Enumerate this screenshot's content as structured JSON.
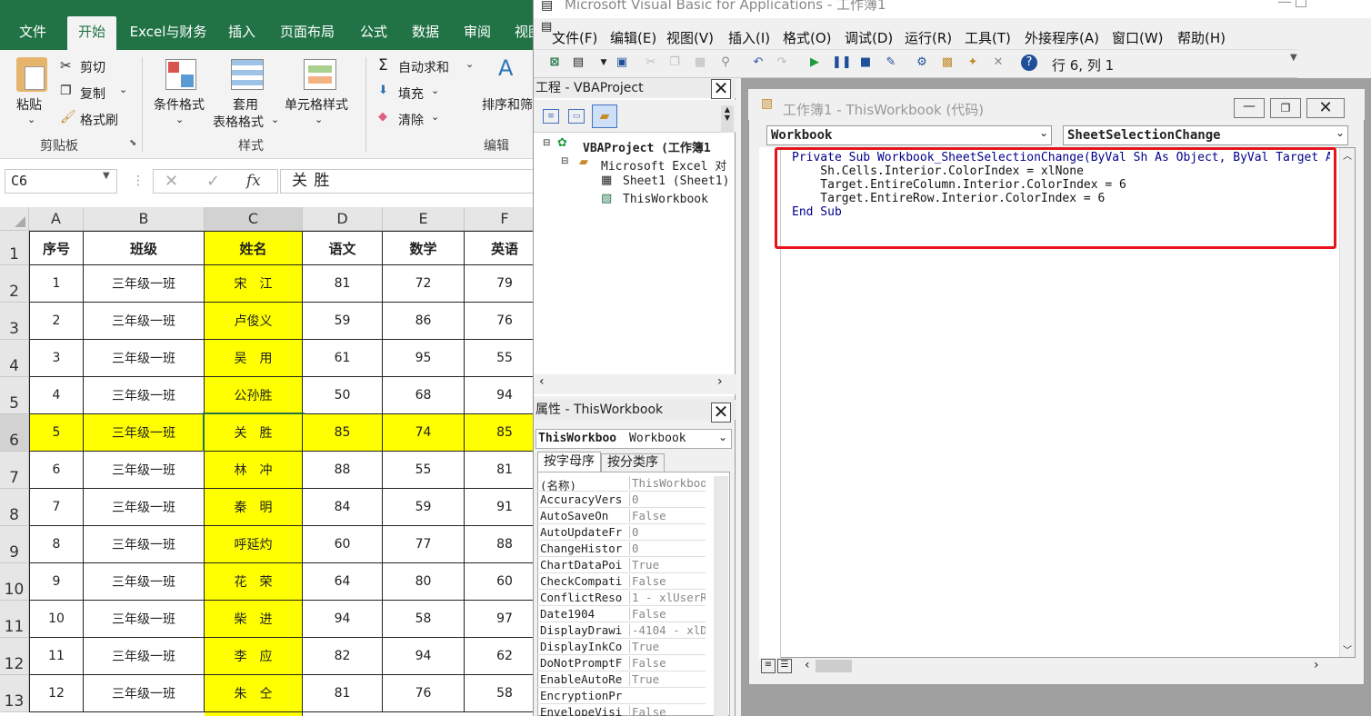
{
  "excel": {
    "tabs": [
      "文件",
      "开始",
      "Excel与财务",
      "插入",
      "页面布局",
      "公式",
      "数据",
      "审阅",
      "视图"
    ],
    "ribbon": {
      "paste": "粘贴",
      "cut": "剪切",
      "copy": "复制",
      "format_painter": "格式刷",
      "cond_format": "条件格式",
      "table_format_1": "套用",
      "table_format_2": "表格格式",
      "cell_style": "单元格样式",
      "autosum": "自动求和",
      "fill": "填充",
      "clear": "清除",
      "sort_filter": "排序和筛",
      "groups": {
        "clipboard": "剪贴板",
        "style": "样式",
        "edit": "编辑"
      }
    },
    "name_box": "C6",
    "formula_value": "关 胜",
    "fx": "fx",
    "columns": [
      "A",
      "B",
      "C",
      "D",
      "E",
      "F"
    ],
    "header": [
      "序号",
      "班级",
      "姓名",
      "语文",
      "数学",
      "英语"
    ],
    "rows": [
      [
        "1",
        "三年级一班",
        "宋　江",
        "81",
        "72",
        "79"
      ],
      [
        "2",
        "三年级一班",
        "卢俊义",
        "59",
        "86",
        "76"
      ],
      [
        "3",
        "三年级一班",
        "吴　用",
        "61",
        "95",
        "55"
      ],
      [
        "4",
        "三年级一班",
        "公孙胜",
        "50",
        "68",
        "94"
      ],
      [
        "5",
        "三年级一班",
        "关　胜",
        "85",
        "74",
        "85"
      ],
      [
        "6",
        "三年级一班",
        "林　冲",
        "88",
        "55",
        "81"
      ],
      [
        "7",
        "三年级一班",
        "秦　明",
        "84",
        "59",
        "91"
      ],
      [
        "8",
        "三年级一班",
        "呼延灼",
        "60",
        "77",
        "88"
      ],
      [
        "9",
        "三年级一班",
        "花　荣",
        "64",
        "80",
        "60"
      ],
      [
        "10",
        "三年级一班",
        "柴　进",
        "94",
        "58",
        "97"
      ],
      [
        "11",
        "三年级一班",
        "李　应",
        "82",
        "94",
        "62"
      ],
      [
        "12",
        "三年级一班",
        "朱　仝",
        "81",
        "76",
        "58"
      ]
    ],
    "row_numbers": [
      "1",
      "2",
      "3",
      "4",
      "5",
      "6",
      "7",
      "8",
      "9",
      "10",
      "11",
      "12",
      "13"
    ],
    "highlight_color": "#ffff00"
  },
  "vbe": {
    "title": "Microsoft Visual Basic for Applications - 工作簿1",
    "menu": [
      "文件(F)",
      "编辑(E)",
      "视图(V)",
      "插入(I)",
      "格式(O)",
      "调试(D)",
      "运行(R)",
      "工具(T)",
      "外接程序(A)",
      "窗口(W)",
      "帮助(H)"
    ],
    "cursor_pos": "行 6, 列 1",
    "project": {
      "title": "工程 - VBAProject",
      "items": [
        "VBAProject (工作簿1",
        "Microsoft Excel 对",
        "Sheet1 (Sheet1)",
        "ThisWorkbook"
      ]
    },
    "properties": {
      "title": "属性 - ThisWorkbook",
      "object_name": "ThisWorkboo",
      "object_type": "Workbook",
      "tabs": [
        "按字母序",
        "按分类序"
      ],
      "rows": [
        [
          "(名称)",
          "ThisWorkboo"
        ],
        [
          "AccuracyVers",
          "0"
        ],
        [
          "AutoSaveOn",
          "False"
        ],
        [
          "AutoUpdateFr",
          "0"
        ],
        [
          "ChangeHistor",
          "0"
        ],
        [
          "ChartDataPoi",
          "True"
        ],
        [
          "CheckCompati",
          "False"
        ],
        [
          "ConflictReso",
          "1 - xlUserR"
        ],
        [
          "Date1904",
          "False"
        ],
        [
          "DisplayDrawi",
          "-4104 - xlD"
        ],
        [
          "DisplayInkCo",
          "True"
        ],
        [
          "DoNotPromptF",
          "False"
        ],
        [
          "EnableAutoRe",
          "True"
        ],
        [
          "EncryptionPr",
          ""
        ],
        [
          "EnvelopeVisi",
          "False"
        ]
      ]
    },
    "code_window": {
      "title": "工作簿1 - ThisWorkbook (代码)",
      "object_dropdown": "Workbook",
      "proc_dropdown": "SheetSelectionChange",
      "lines": [
        "Private Sub Workbook_SheetSelectionChange(ByVal Sh As Object, ByVal Target As Range)",
        "    Sh.Cells.Interior.ColorIndex = xlNone",
        "    Target.EntireColumn.Interior.ColorIndex = 6",
        "    Target.EntireRow.Interior.ColorIndex = 6",
        "End Sub"
      ],
      "annotation_color": "#e8141c"
    }
  }
}
